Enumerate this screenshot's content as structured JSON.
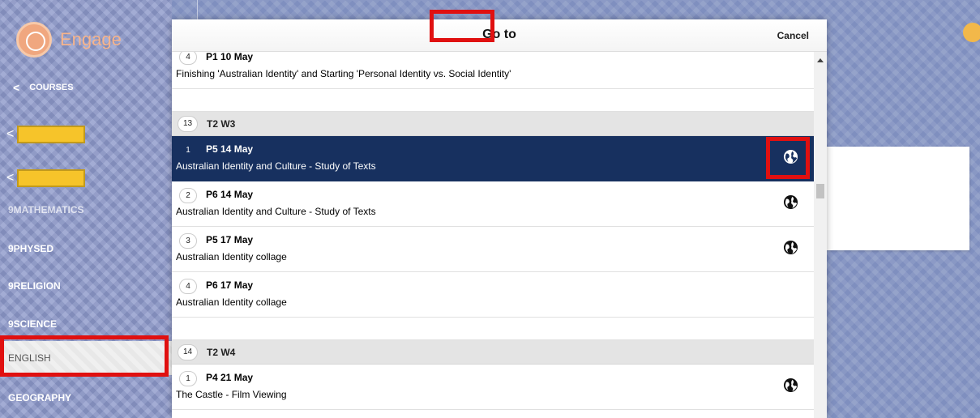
{
  "app": {
    "name": "Engage"
  },
  "sidebar": {
    "courses_label": "COURSES",
    "partial_item": "9MATHEMATICS",
    "items": [
      {
        "label": "9PHYSED"
      },
      {
        "label": "9RELIGION"
      },
      {
        "label": "9SCIENCE"
      },
      {
        "label": "ENGLISH"
      },
      {
        "label": "GEOGRAPHY"
      }
    ]
  },
  "modal": {
    "title": "Go to",
    "cancel_label": "Cancel"
  },
  "lessons": {
    "top": {
      "num": "4",
      "period": "P1  10 May",
      "desc": "Finishing 'Australian Identity' and Starting 'Personal Identity vs. Social Identity'"
    },
    "week13": {
      "num": "13",
      "label": "T2  W3"
    },
    "w13": [
      {
        "num": "1",
        "period": "P5  14 May",
        "desc": "Australian Identity and Culture - Study of Texts"
      },
      {
        "num": "2",
        "period": "P6  14 May",
        "desc": "Australian Identity and Culture - Study of Texts"
      },
      {
        "num": "3",
        "period": "P5  17 May",
        "desc": "Australian Identity collage"
      },
      {
        "num": "4",
        "period": "P6  17 May",
        "desc": "Australian Identity collage"
      }
    ],
    "week14": {
      "num": "14",
      "label": "T2  W4"
    },
    "w14": [
      {
        "num": "1",
        "period": "P4  21 May",
        "desc": "The Castle - Film Viewing"
      }
    ]
  },
  "colors": {
    "selected_row": "#17305f",
    "highlight": "#e01010",
    "course_highlight": "#f6c42a",
    "logo": "#f0a77f"
  },
  "icons": {
    "public": "globe-icon",
    "back": "chevron-left-icon"
  }
}
